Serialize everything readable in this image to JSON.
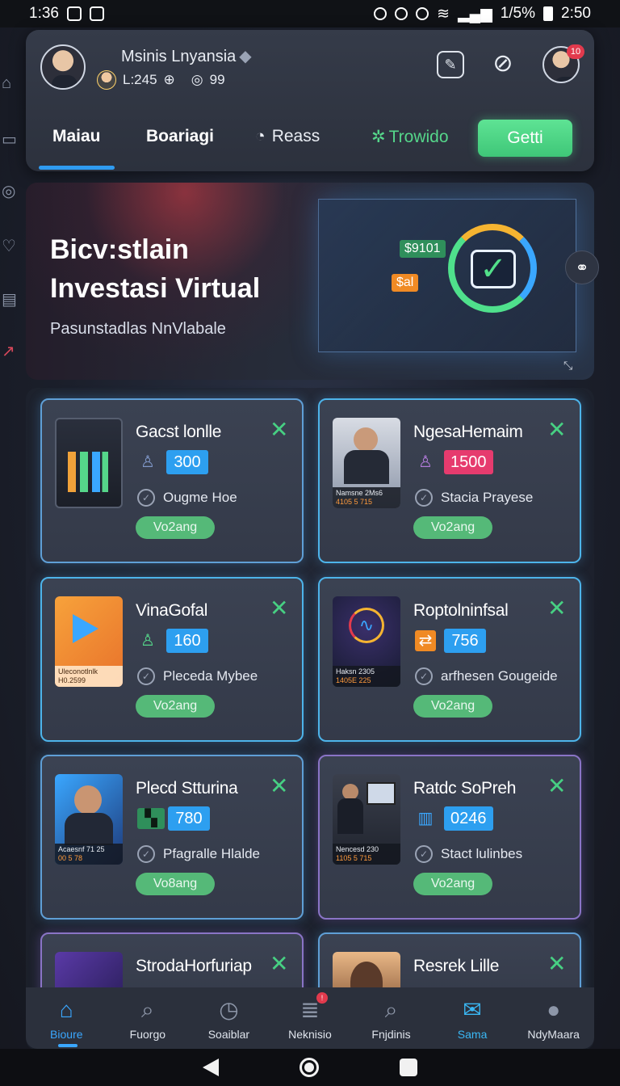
{
  "status_bar": {
    "time_left": "1:36",
    "battery": "1/5%",
    "time_right": "2:50"
  },
  "header": {
    "user_name": "Msinis Lnyansia",
    "level": "L:245",
    "coins": "99",
    "notification_count": "10"
  },
  "tabs": [
    {
      "label": "Maiau"
    },
    {
      "label": "Boariagi"
    },
    {
      "label": "Reass"
    },
    {
      "label": "Trowido"
    }
  ],
  "cta_label": "Getti",
  "hero": {
    "title_line1": "Bicv:stlain",
    "title_line2": "Investasi Virtual",
    "subtitle": "Pasunstadlas NnVlabale",
    "screen_label_top": "$9101",
    "screen_label_mid": "$al"
  },
  "cards": [
    {
      "title": "Gacst lonlle",
      "stat": "300",
      "stat_color": "#2d9ff0",
      "desc": "Ougme Hoe",
      "button": "Vo2ang",
      "caption1": "",
      "caption2": ""
    },
    {
      "title": "NgesaHemaim",
      "stat": "1500",
      "stat_color": "#e63b6e",
      "desc": "Stacia Prayese",
      "button": "Vo2ang",
      "caption1": "Namsne 2Ms6",
      "caption2": "4105 5 715"
    },
    {
      "title": "VinaGofal",
      "stat": "160",
      "stat_color": "#2d9ff0",
      "desc": "Pleceda Mybee",
      "button": "Vo2ang",
      "caption1": "Uleconotlnlk",
      "caption2": "H0.2599"
    },
    {
      "title": "Roptolninfsal",
      "stat": "756",
      "stat_color": "#2d9ff0",
      "desc": "arfhesen Gougeide",
      "button": "Vo2ang",
      "caption1": "Haksn 2305",
      "caption2": "1405E 225"
    },
    {
      "title": "Plecd Stturina",
      "stat": "780",
      "stat_color": "#2d9ff0",
      "desc": "Pfagralle Hlalde",
      "button": "Vo8ang",
      "caption1": "Acaesnf 71 25",
      "caption2": "00 5 78"
    },
    {
      "title": "Ratdc SoPreh",
      "stat": "0246",
      "stat_color": "#2d9ff0",
      "desc": "Stact lulinbes",
      "button": "Vo2ang",
      "caption1": "Nencesd 230",
      "caption2": "1105 5 715"
    },
    {
      "title": "StrodaHorfuriap",
      "stat": "",
      "stat_color": "#2d9ff0",
      "desc": "",
      "button": "",
      "caption1": "",
      "caption2": ""
    },
    {
      "title": "Resrek Lille",
      "stat": "",
      "stat_color": "#2d9ff0",
      "desc": "",
      "button": "",
      "caption1": "",
      "caption2": ""
    }
  ],
  "bottom_nav": [
    {
      "label": "Bioure",
      "icon": "home-icon"
    },
    {
      "label": "Fuorgo",
      "icon": "search-coin-icon"
    },
    {
      "label": "Soaiblar",
      "icon": "timer-icon"
    },
    {
      "label": "Neknisio",
      "icon": "stack-icon"
    },
    {
      "label": "Fnjdinis",
      "icon": "search-icon"
    },
    {
      "label": "Sama",
      "icon": "mail-icon"
    },
    {
      "label": "NdyMaara",
      "icon": "person-icon"
    }
  ]
}
